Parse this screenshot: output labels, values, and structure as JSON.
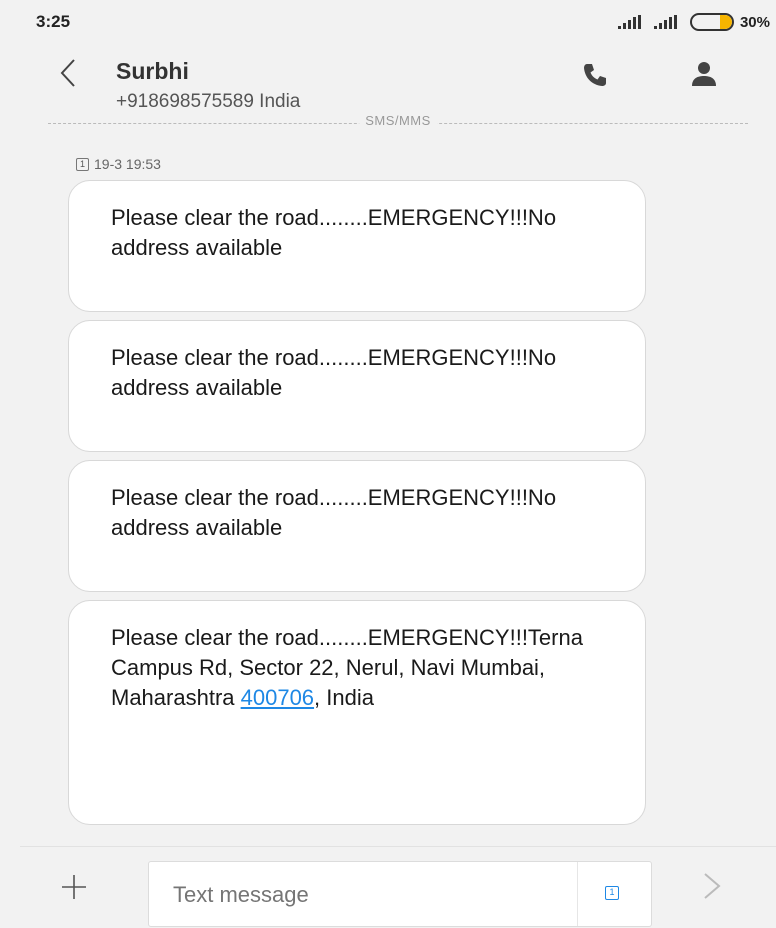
{
  "status_bar": {
    "time": "3:25",
    "battery_percent": "30%",
    "battery_level": 0.3,
    "colors": {
      "battery": "#f7b500"
    }
  },
  "header": {
    "back_icon": "chevron-left-icon",
    "contact_name": "Surbhi",
    "contact_number": "+918698575589 India",
    "call_icon": "phone-icon",
    "contact_icon": "person-icon"
  },
  "thread": {
    "channel_label": "SMS/MMS",
    "sim_badge": "1",
    "timestamp": "19-3 19:53",
    "messages": [
      {
        "text": "Please clear the road........EMERGENCY!!!No address available"
      },
      {
        "text": "Please clear the road........EMERGENCY!!!No address available"
      },
      {
        "text": "Please clear the road........EMERGENCY!!!No address available"
      },
      {
        "text_before": "Please clear the road........EMERGENCY!!!Terna Campus Rd, Sector 22, Nerul, Navi Mumbai, Maharashtra ",
        "link": "400706",
        "text_after": ", India"
      }
    ]
  },
  "composer": {
    "attach_icon": "plus-icon",
    "placeholder": "Text message",
    "sim_select": "1",
    "send_icon": "chevron-right-icon",
    "colors": {
      "accent": "#1e88e5"
    }
  }
}
